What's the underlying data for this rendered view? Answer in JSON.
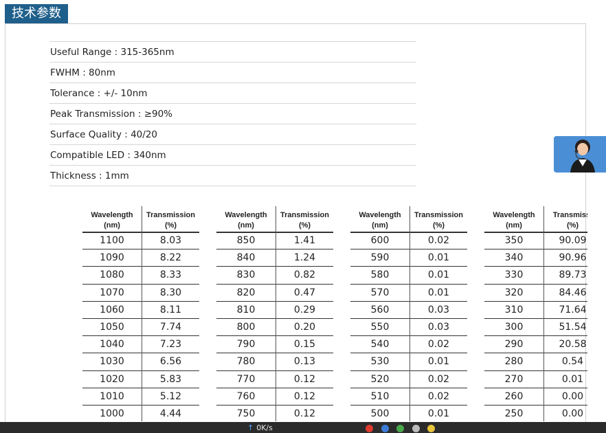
{
  "header": {
    "title": "技术参数"
  },
  "specs": [
    "Useful Range : 315-365nm",
    "FWHM : 80nm",
    "Tolerance : +/- 10nm",
    "Peak Transmission : ≥90%",
    "Surface Quality : 40/20",
    "Compatible LED : 340nm",
    "Thickness : 1mm"
  ],
  "tables": {
    "col1_header": [
      "Wavelength",
      "(nm)"
    ],
    "col2_header": [
      "Transmission",
      "(%)"
    ],
    "col2_header_clipped": [
      "Transmissi",
      "(%)"
    ],
    "groups": [
      {
        "rows": [
          [
            "1100",
            "8.03"
          ],
          [
            "1090",
            "8.22"
          ],
          [
            "1080",
            "8.33"
          ],
          [
            "1070",
            "8.30"
          ],
          [
            "1060",
            "8.11"
          ],
          [
            "1050",
            "7.74"
          ],
          [
            "1040",
            "7.23"
          ],
          [
            "1030",
            "6.56"
          ],
          [
            "1020",
            "5.83"
          ],
          [
            "1010",
            "5.12"
          ],
          [
            "1000",
            "4.44"
          ]
        ]
      },
      {
        "rows": [
          [
            "850",
            "1.41"
          ],
          [
            "840",
            "1.24"
          ],
          [
            "830",
            "0.82"
          ],
          [
            "820",
            "0.47"
          ],
          [
            "810",
            "0.29"
          ],
          [
            "800",
            "0.20"
          ],
          [
            "790",
            "0.15"
          ],
          [
            "780",
            "0.13"
          ],
          [
            "770",
            "0.12"
          ],
          [
            "760",
            "0.12"
          ],
          [
            "750",
            "0.12"
          ]
        ]
      },
      {
        "rows": [
          [
            "600",
            "0.02"
          ],
          [
            "590",
            "0.01"
          ],
          [
            "580",
            "0.01"
          ],
          [
            "570",
            "0.01"
          ],
          [
            "560",
            "0.03"
          ],
          [
            "550",
            "0.03"
          ],
          [
            "540",
            "0.02"
          ],
          [
            "530",
            "0.01"
          ],
          [
            "520",
            "0.02"
          ],
          [
            "510",
            "0.02"
          ],
          [
            "500",
            "0.01"
          ]
        ]
      },
      {
        "rows": [
          [
            "350",
            "90.09"
          ],
          [
            "340",
            "90.96"
          ],
          [
            "330",
            "89.73"
          ],
          [
            "320",
            "84.46"
          ],
          [
            "310",
            "71.64"
          ],
          [
            "300",
            "51.54"
          ],
          [
            "290",
            "20.58"
          ],
          [
            "280",
            "0.54"
          ],
          [
            "270",
            "0.01"
          ],
          [
            "260",
            "0.00"
          ],
          [
            "250",
            "0.00"
          ]
        ]
      }
    ]
  },
  "taskbar": {
    "speed": "0K/s"
  },
  "colors": {
    "header_bg": "#1f5f8b",
    "agent_bg": "#4a8fd6",
    "taskbar_bg": "#2b2b2b"
  },
  "icons": {
    "agent": "customer-service-avatar-icon",
    "up_arrow": "upload-arrow-icon"
  }
}
